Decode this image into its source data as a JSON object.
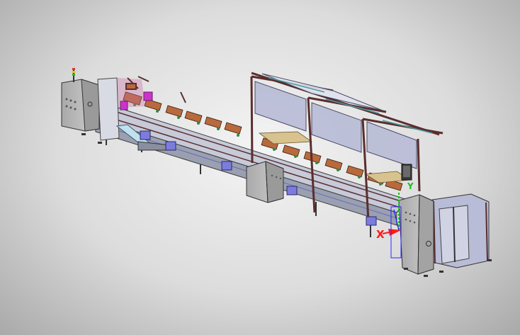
{
  "scene": {
    "background": [
      "#f4f4f4",
      "#dcdcdc",
      "#a9a9a9"
    ],
    "frame_color": "#5a2e2e",
    "panel_color": "#b8bcd6",
    "box_color": "#7c7cdc",
    "fixture_color": "#b86a3c",
    "cabinet_color": "#b9b9b9",
    "wood_color": "#d8c28e"
  },
  "triad": {
    "x_label": "X",
    "y_label": "Y",
    "x_color": "#ff1a1a",
    "y_color": "#18c418",
    "z_color": "#2a2aff"
  }
}
